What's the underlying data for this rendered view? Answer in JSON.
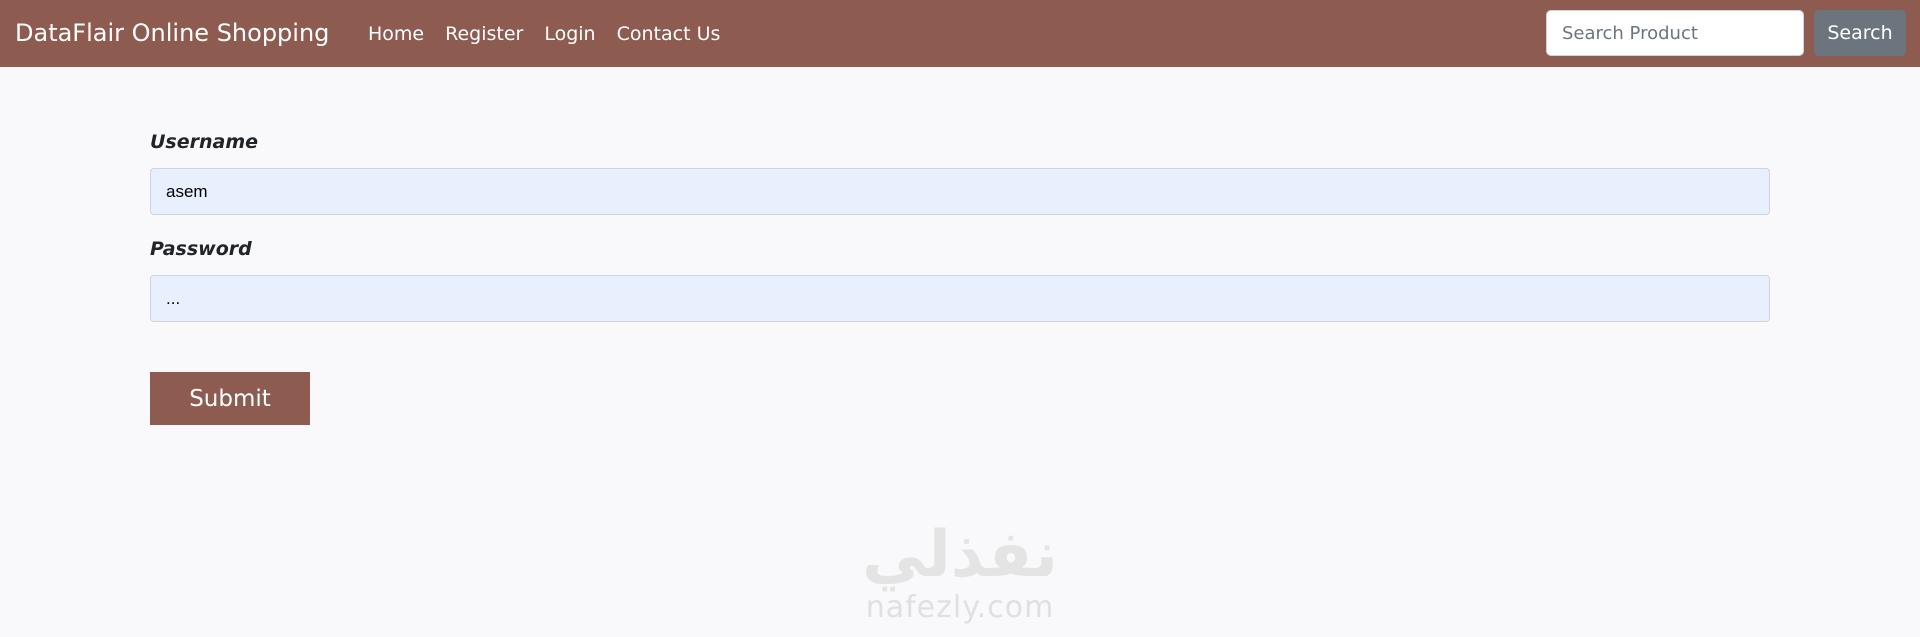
{
  "navbar": {
    "brand": "DataFlair Online Shopping",
    "links": [
      "Home",
      "Register",
      "Login",
      "Contact Us"
    ],
    "search": {
      "placeholder": "Search Product",
      "value": "",
      "button_label": "Search"
    },
    "bg_color": "#8d5b4f"
  },
  "form": {
    "username": {
      "label": "Username",
      "value": "asem"
    },
    "password": {
      "label": "Password",
      "value": "..."
    },
    "submit_label": "Submit"
  },
  "watermark": {
    "arabic": "نفذلي",
    "latin": "nafezly.com"
  }
}
